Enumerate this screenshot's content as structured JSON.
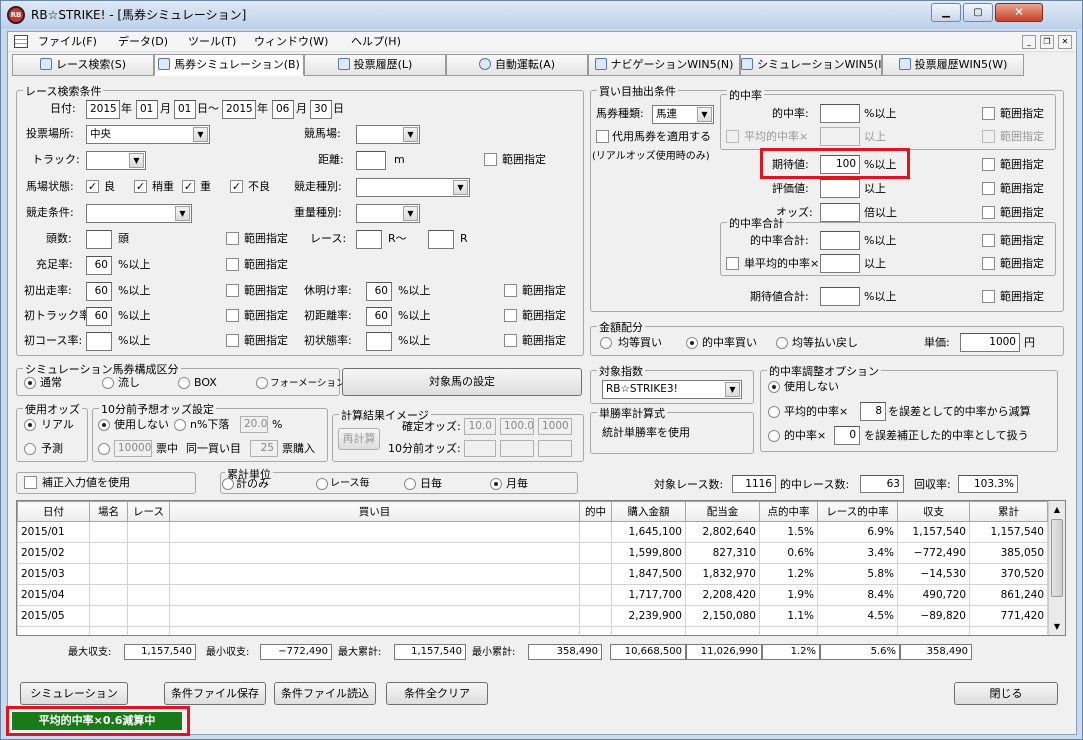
{
  "window": {
    "title": "RB☆STRIKE! - [馬券シミュレーション]"
  },
  "menu": [
    "ファイル(F)",
    "データ(D)",
    "ツール(T)",
    "ウィンドウ(W)",
    "ヘルプ(H)"
  ],
  "tabs": [
    "レース検索(S)",
    "馬券シミュレーション(B)",
    "投票履歴(L)",
    "自動運転(A)",
    "ナビゲーションWIN5(N)",
    "シミュレーションWIN5(I)",
    "投票履歴WIN5(W)"
  ],
  "race": {
    "legend": "レース検索条件",
    "date_label": "日付:",
    "y1": "2015",
    "m1": "01",
    "d1": "01",
    "y2": "2015",
    "m2": "06",
    "d2": "30",
    "u_year": "年",
    "u_month": "月",
    "u_day_range": "日〜",
    "u_day": "日",
    "place_label": "投票場所:",
    "place_value": "中央",
    "track_label": "競馬場:",
    "surface_label": "トラック:",
    "distance_label": "距離:",
    "distance_unit": "m",
    "condition_label": "馬場状態:",
    "cond": [
      "良",
      "稍重",
      "重",
      "不良"
    ],
    "kind_label": "競走種別:",
    "race_cond_label": "競走条件:",
    "weight_label": "重量種別:",
    "heads_label": "頭数:",
    "heads_unit": "頭",
    "range": "範囲指定",
    "race_label": "レース:",
    "r_from": "R〜",
    "r_to": "R",
    "rate1_label": "充足率:",
    "rate1_value": "60",
    "pct_over": "%以上",
    "first_label": "初出走率:",
    "first_value": "60",
    "rest_label": "休明け率:",
    "rest_value": "60",
    "firsttrack_label": "初トラック率:",
    "firsttrack_value": "60",
    "firstdist_label": "初距離率:",
    "firstdist_value": "60",
    "firstcourse_label": "初コース率:",
    "firststate_label": "初状態率:"
  },
  "comp": {
    "legend": "シミュレーション馬券構成区分",
    "opts": [
      "通常",
      "流し",
      "BOX",
      "フォーメーション"
    ],
    "target_button": "対象馬の設定"
  },
  "odds": {
    "legend": "使用オッズ",
    "opts": [
      "リアル",
      "予測"
    ]
  },
  "odds10": {
    "legend": "10分前予想オッズ設定",
    "no_use": "使用しない",
    "drop": "n%下落",
    "drop_value": "20.0",
    "pct": "%",
    "yen_value": "10000",
    "yen_text": "票中",
    "same_text": "同一買い目",
    "count_value": "25",
    "buy_text": "票購入"
  },
  "calc": {
    "legend": "計算結果イメージ",
    "button": "再計算",
    "fixed_label": "確定オッズ:",
    "min10_label": "10分前オッズ:",
    "v1": "10.0",
    "v2": "100.0",
    "v3": "1000"
  },
  "fix": {
    "label": "補正入力値を使用"
  },
  "unit": {
    "legend": "累計単位",
    "opts": [
      "計のみ",
      "レース毎",
      "日毎",
      "月毎"
    ]
  },
  "buy": {
    "legend": "買い目抽出条件",
    "type_label": "馬券種類:",
    "type_value": "馬連",
    "substitute": "代用馬券を適用する",
    "substitute_note": "(リアルオッズ使用時のみ)",
    "hit_legend": "的中率",
    "hit_label": "的中率:",
    "avg_hit_label": "平均的中率×",
    "over": "以上",
    "pct_over": "%以上",
    "expect_label": "期待値:",
    "expect_value": "100",
    "eval_label": "評価値:",
    "odds_label": "オッズ:",
    "times_over": "倍以上",
    "sum_legend": "的中率合計",
    "sum_label": "的中率合計:",
    "single_avg_label": "単平均的中率×",
    "expect_total_label": "期待値合計:",
    "range": "範囲指定"
  },
  "alloc": {
    "legend": "金額配分",
    "opts": [
      "均等買い",
      "的中率買い",
      "均等払い戻し"
    ],
    "unit_label": "単価:",
    "unit_value": "1000",
    "yen": "円"
  },
  "target": {
    "legend": "対象指数",
    "value": "RB☆STRIKE3!"
  },
  "single": {
    "legend": "単勝率計算式",
    "value": "統計単勝率を使用"
  },
  "adjust": {
    "legend": "的中率調整オプション",
    "no_use": "使用しない",
    "opt2a": "平均的中率×",
    "opt2_value": "8",
    "opt2b": "を誤差として的中率から減算",
    "opt3a": "的中率×",
    "opt3_value": "0",
    "opt3b": "を誤差補正した的中率として扱う"
  },
  "stats": {
    "races_label": "対象レース数:",
    "races": "1116",
    "hits_label": "的中レース数:",
    "hits": "63",
    "recovery_label": "回収率:",
    "recovery": "103.3%"
  },
  "table": {
    "headers": [
      "日付",
      "場名",
      "レース",
      "買い目",
      "的中",
      "購入金額",
      "配当金",
      "点的中率",
      "レース的中率",
      "収支",
      "累計"
    ],
    "rows": [
      [
        "2015/01",
        "",
        "",
        "",
        "",
        "1,645,100",
        "2,802,640",
        "1.5%",
        "6.9%",
        "1,157,540",
        "1,157,540"
      ],
      [
        "2015/02",
        "",
        "",
        "",
        "",
        "1,599,800",
        "827,310",
        "0.6%",
        "3.4%",
        "−772,490",
        "385,050"
      ],
      [
        "2015/03",
        "",
        "",
        "",
        "",
        "1,847,500",
        "1,832,970",
        "1.2%",
        "5.8%",
        "−14,530",
        "370,520"
      ],
      [
        "2015/04",
        "",
        "",
        "",
        "",
        "1,717,700",
        "2,208,420",
        "1.9%",
        "8.4%",
        "490,720",
        "861,240"
      ],
      [
        "2015/05",
        "",
        "",
        "",
        "",
        "2,239,900",
        "2,150,080",
        "1.1%",
        "4.5%",
        "−89,820",
        "771,420"
      ]
    ]
  },
  "summary": {
    "max_label": "最大収支:",
    "max": "1,157,540",
    "min_label": "最小収支:",
    "min": "−772,490",
    "maxc_label": "最大累計:",
    "maxc": "1,157,540",
    "minc_label": "最小累計:",
    "minc": "358,490",
    "t_buy": "10,668,500",
    "t_pay": "11,026,990",
    "t_point": "1.2%",
    "t_race": "5.6%",
    "t_total": "358,490"
  },
  "buttons": {
    "sim": "シミュレーション",
    "save": "条件ファイル保存",
    "load": "条件ファイル読込",
    "clear": "条件全クリア",
    "close": "閉じる"
  },
  "status": {
    "text": "平均的中率×0.6減算中"
  },
  "colors": {
    "highlight": "#e0141e",
    "status_bg": "#1a7a1a"
  }
}
